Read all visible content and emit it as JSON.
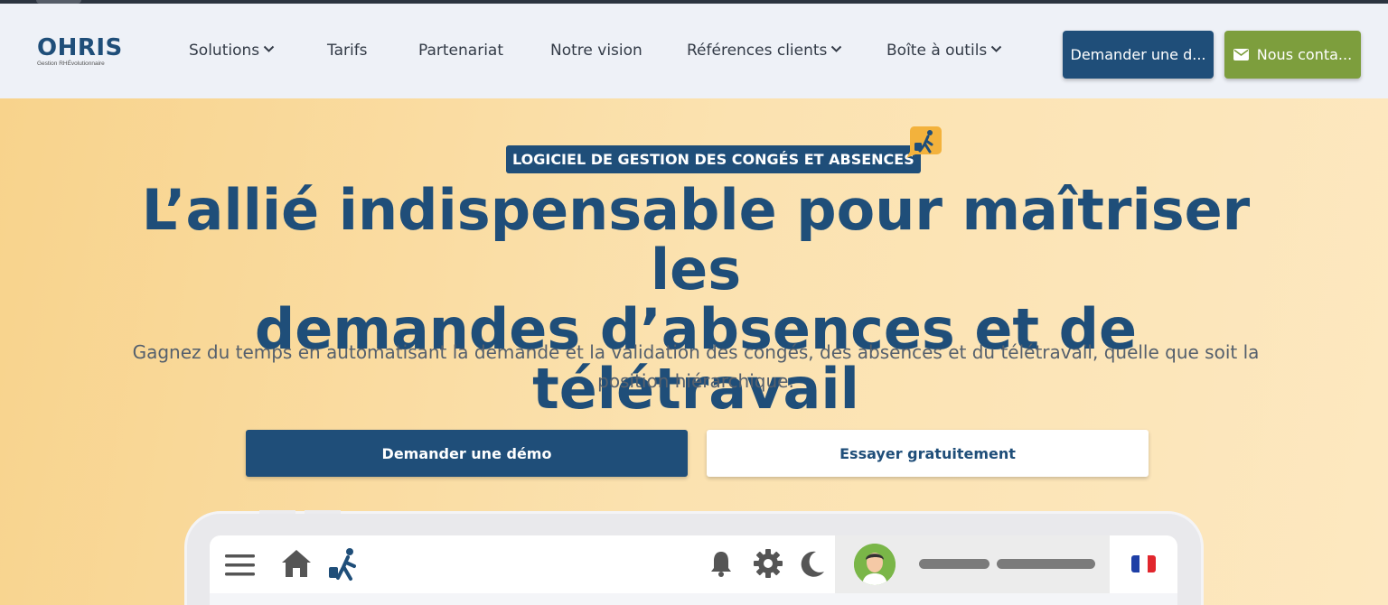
{
  "brand": {
    "logo_text": "OHRIS",
    "tagline": "Gestion RHÉvolutionnaire",
    "colors": {
      "primary": "#1f4e79",
      "accent_green": "#7d9e3d",
      "hero_bg": "#f8d38c"
    }
  },
  "nav": {
    "items": [
      {
        "label": "Solutions",
        "has_dropdown": true
      },
      {
        "label": "Tarifs",
        "has_dropdown": false
      },
      {
        "label": "Partenariat",
        "has_dropdown": false
      },
      {
        "label": "Notre vision",
        "has_dropdown": false
      },
      {
        "label": "Références clients",
        "has_dropdown": true
      },
      {
        "label": "Boîte à outils",
        "has_dropdown": true
      }
    ],
    "demo_button": "Demander une d...",
    "contact_button": "Nous conta...",
    "contact_icon": "envelope-icon"
  },
  "hero": {
    "badge": "LOGICIEL DE GESTION DES CONGÉS ET ABSENCES",
    "badge_icon": "traveler-icon",
    "title_line1": "L’allié indispensable pour maîtriser les",
    "title_line2": "demandes d’absences et de télétravail",
    "subtitle": "Gagnez du temps en automatisant la demande et la validation des congés, des absences et du télétravail, quelle que soit la position hiérarchique.",
    "cta_primary": "Demander une démo",
    "cta_secondary": "Essayer gratuitement"
  },
  "app_preview": {
    "left_icons": [
      "menu-icon",
      "home-icon",
      "traveler-icon"
    ],
    "right_icons": [
      "bell-icon",
      "gear-icon",
      "moon-icon"
    ],
    "language_flag": "fr"
  }
}
